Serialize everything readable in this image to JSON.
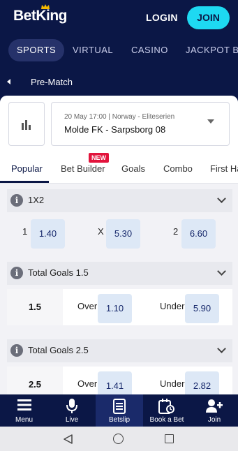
{
  "header": {
    "logo_text": "BetKing",
    "login_label": "LOGIN",
    "join_label": "JOIN"
  },
  "categories": [
    "SPORTS",
    "VIRTUAL",
    "CASINO",
    "JACKPOT BE"
  ],
  "prematch": {
    "title": "Pre-Match"
  },
  "match": {
    "meta": "20 May 17:00 | Norway - Eliteserien",
    "name": "Molde FK - Sarpsborg 08"
  },
  "tabs": [
    "Popular",
    "Bet Builder",
    "Goals",
    "Combo",
    "First Ha"
  ],
  "new_badge": "NEW",
  "markets": [
    {
      "title": "1X2",
      "selections": [
        {
          "label": "1",
          "odds": "1.40"
        },
        {
          "label": "X",
          "odds": "5.30"
        },
        {
          "label": "2",
          "odds": "6.60"
        }
      ]
    },
    {
      "title": "Total Goals 1.5",
      "line": "1.5",
      "selections": [
        {
          "label": "Over",
          "odds": "1.10"
        },
        {
          "label": "Under",
          "odds": "5.90"
        }
      ]
    },
    {
      "title": "Total Goals 2.5",
      "line": "2.5",
      "selections": [
        {
          "label": "Over",
          "odds": "1.41"
        },
        {
          "label": "Under",
          "odds": "2.82"
        }
      ]
    }
  ],
  "bottom_nav": [
    "Menu",
    "Live",
    "Betslip",
    "Book a Bet",
    "Join"
  ],
  "colors": {
    "brand_navy": "#0b1746",
    "accent_cyan": "#1ed9f2",
    "badge_red": "#e2143c",
    "odds_bg": "#dde8f6"
  }
}
